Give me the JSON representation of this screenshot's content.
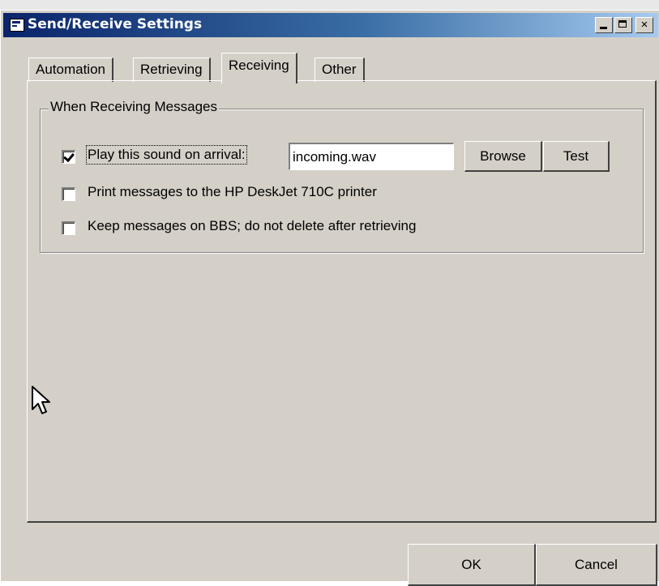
{
  "window": {
    "title": "Send/Receive Settings",
    "controls": {
      "minimize": "_",
      "maximize": "□",
      "close": "✕"
    }
  },
  "tabs": [
    {
      "label": "Automation"
    },
    {
      "label": "Retrieving"
    },
    {
      "label": "Receiving"
    },
    {
      "label": "Other"
    }
  ],
  "active_tab": "Receiving",
  "group": {
    "title": "When Receiving Messages",
    "options": [
      {
        "label": "Play this sound on arrival:",
        "checked": true
      },
      {
        "label": "Print messages to the HP DeskJet 710C printer",
        "checked": false
      },
      {
        "label": "Keep messages on BBS; do not delete after retrieving",
        "checked": false
      }
    ],
    "sound_file": "incoming.wav",
    "browse_label": "Browse",
    "test_label": "Test"
  },
  "footer": {
    "ok_label": "OK",
    "cancel_label": "Cancel"
  },
  "icons": {
    "title_icon": "window-app-icon",
    "cursor": "mouse-pointer-icon"
  }
}
